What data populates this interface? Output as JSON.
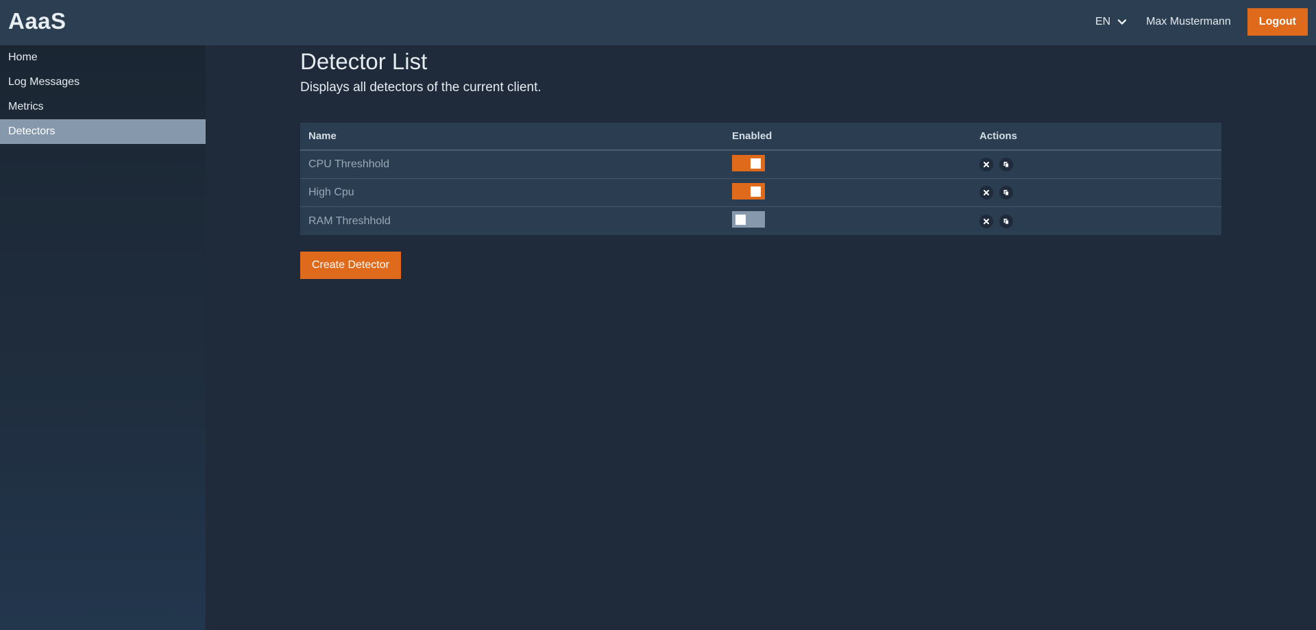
{
  "app": {
    "brand": "AaaS"
  },
  "header": {
    "language": "EN",
    "user_name": "Max Mustermann",
    "logout_label": "Logout",
    "accent_color": "#e06a1b"
  },
  "sidebar": {
    "items": [
      {
        "label": "Home",
        "active": false
      },
      {
        "label": "Log Messages",
        "active": false
      },
      {
        "label": "Metrics",
        "active": false
      },
      {
        "label": "Detectors",
        "active": true
      }
    ]
  },
  "main": {
    "title": "Detector List",
    "subtitle": "Displays all detectors of the current client.",
    "table": {
      "columns": [
        "Name",
        "Enabled",
        "Actions"
      ],
      "rows": [
        {
          "name": "CPU Threshhold",
          "enabled": true,
          "actions": [
            "delete-icon",
            "copy-icon"
          ]
        },
        {
          "name": "High Cpu",
          "enabled": true,
          "actions": [
            "delete-icon",
            "copy-icon"
          ]
        },
        {
          "name": "RAM Threshhold",
          "enabled": false,
          "actions": [
            "delete-icon",
            "copy-icon"
          ]
        }
      ]
    },
    "create_label": "Create Detector"
  }
}
